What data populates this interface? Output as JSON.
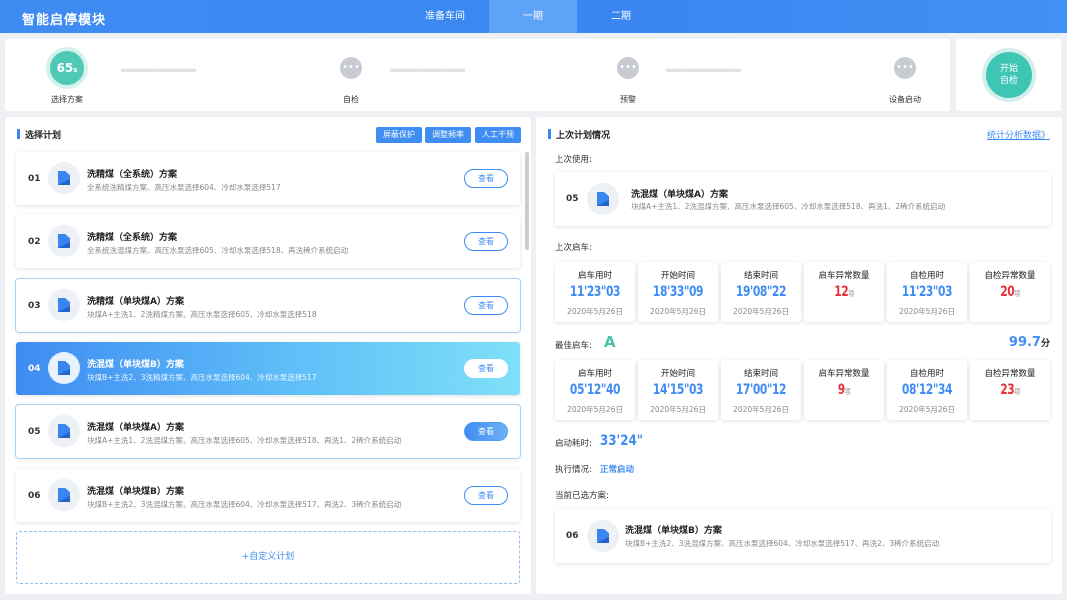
{
  "header": {
    "title": "智能启停模块",
    "tabs": [
      {
        "label": "准备车间"
      },
      {
        "label": "一期"
      },
      {
        "label": "二期"
      }
    ]
  },
  "steps": [
    {
      "label": "选择方案",
      "badge": "65",
      "badge_sub": "s"
    },
    {
      "label": "自检"
    },
    {
      "label": "预警"
    },
    {
      "label": "设备启动"
    }
  ],
  "start_button": {
    "line1": "开始",
    "line2": "自检"
  },
  "left_panel": {
    "title": "选择计划",
    "buttons": [
      "屏蔽保护",
      "调整频率",
      "人工干预"
    ],
    "view_label": "查看",
    "custom_label": "+自定义计划",
    "plans": [
      {
        "num": "01",
        "name": "洗精煤（全系统）方案",
        "desc": "全系统洗精煤方案、高压水泵选择604、冷却水泵选择517"
      },
      {
        "num": "02",
        "name": "洗精煤（全系统）方案",
        "desc": "全系统洗混煤方案、高压水泵选择605、冷却水泵选择518、再洗稀介系统启动"
      },
      {
        "num": "03",
        "name": "洗精煤（单块煤A）方案",
        "desc": "块煤A+主洗1、2洗精煤方案、高压水泵选择605、冷却水泵选择518"
      },
      {
        "num": "04",
        "name": "洗混煤（单块煤B）方案",
        "desc": "块煤B+主洗2、3洗精煤方案、高压水泵选择604、冷却水泵选择517"
      },
      {
        "num": "05",
        "name": "洗混煤（单块煤A）方案",
        "desc": "块煤A+主洗1、2洗混煤方案、高压水泵选择605、冷却水泵选择518、再洗1、2稀介系统启动"
      },
      {
        "num": "06",
        "name": "洗混煤（单块煤B）方案",
        "desc": "块煤B+主洗2、3洗混煤方案、高压水泵选择604、冷却水泵选择517、再洗2、3稀介系统启动"
      }
    ]
  },
  "right_panel": {
    "title": "上次计划情况",
    "link": "统计分析数据》",
    "last_used_label": "上次使用:",
    "last_used": {
      "num": "05",
      "name": "洗混煤（单块煤A）方案",
      "desc": "块煤A+主洗1、2洗混煤方案、高压水泵选择605、冷却水泵选择518、再洗1、2稀介系统启动"
    },
    "last_start_label": "上次启车:",
    "last_start": [
      {
        "title": "启车用时",
        "value": "11'23\"03",
        "date": "2020年5月26日"
      },
      {
        "title": "开始时间",
        "value": "18'33\"09",
        "date": "2020年5月26日"
      },
      {
        "title": "结束时间",
        "value": "19'08\"22",
        "date": "2020年5月26日"
      },
      {
        "title": "启车异常数量",
        "value": "12",
        "unit": "项"
      },
      {
        "title": "自检用时",
        "value": "11'23\"03",
        "date": "2020年5月26日"
      },
      {
        "title": "自检异常数量",
        "value": "20",
        "unit": "项"
      }
    ],
    "best_label": "最佳启车:",
    "best_grade": "A",
    "best_score": "99.7",
    "best_score_unit": "分",
    "best_start": [
      {
        "title": "启车用时",
        "value": "05'12\"40",
        "date": "2020年5月26日"
      },
      {
        "title": "开始时间",
        "value": "14'15\"03",
        "date": "2020年5月26日"
      },
      {
        "title": "结束时间",
        "value": "17'00\"12",
        "date": "2020年5月26日"
      },
      {
        "title": "启车异常数量",
        "value": "9",
        "unit": "项"
      },
      {
        "title": "自检用时",
        "value": "08'12\"34",
        "date": "2020年5月26日"
      },
      {
        "title": "自检异常数量",
        "value": "23",
        "unit": "项"
      }
    ],
    "duration_label": "启动耗时:",
    "duration_value": "33'24\"",
    "exec_label": "执行情况:",
    "exec_value": "正常启动",
    "current_label": "当前已选方案:",
    "current": {
      "num": "06",
      "name": "洗混煤（单块煤B）方案",
      "desc": "块煤B+主洗2、3洗混煤方案、高压水泵选择604、冷却水泵选择517、再洗2、3稀介系统启动"
    }
  }
}
